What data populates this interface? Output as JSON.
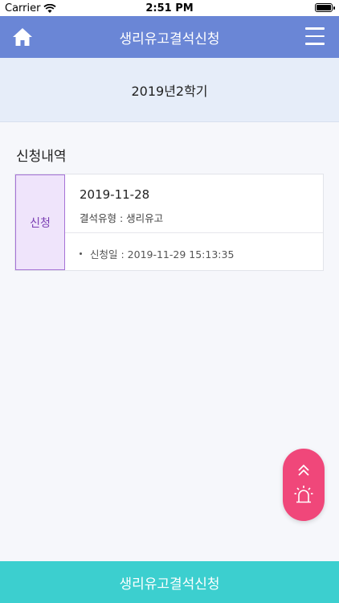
{
  "status_bar": {
    "carrier": "Carrier",
    "time": "2:51 PM",
    "wifi_icon": "wifi-icon",
    "battery_icon": "battery-icon"
  },
  "nav": {
    "title": "생리유고결석신청",
    "home_icon": "home-icon",
    "menu_icon": "hamburger-menu-icon"
  },
  "semester": "2019년2학기",
  "section_title": "신청내역",
  "records": [
    {
      "status": "신청",
      "date": "2019-11-28",
      "absence_type": "결석유형 : 생리유고",
      "applied_at": "신청일 : 2019-11-29 15:13:35"
    }
  ],
  "fab": {
    "up_icon": "double-chevron-up-icon",
    "alarm_icon": "siren-icon"
  },
  "bottom_button": "생리유고결석신청",
  "colors": {
    "nav": "#6a86d6",
    "band": "#e6edf9",
    "status_border": "#a673d6",
    "status_fill": "#efe4fb",
    "fab": "#f0477a",
    "bottom": "#3ccfcf"
  }
}
